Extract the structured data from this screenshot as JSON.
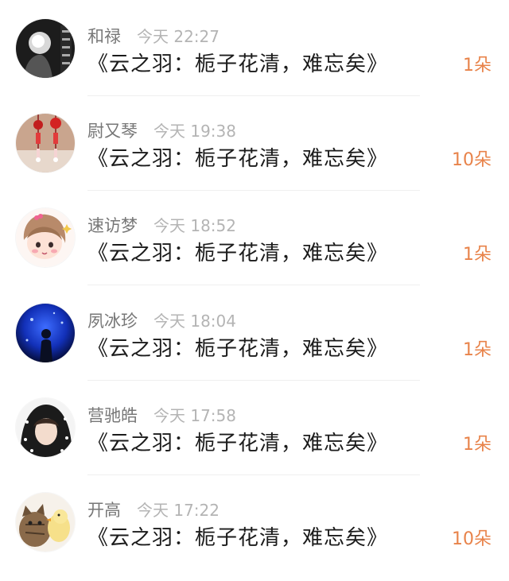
{
  "records": [
    {
      "name": "和禄",
      "time": "今天 22:27",
      "title": "《云之羽：栀子花清，难忘矣》",
      "gift": "1朵",
      "avatar_icon": "user-avatar-dark"
    },
    {
      "name": "尉又琴",
      "time": "今天 19:38",
      "title": "《云之羽：栀子花清，难忘矣》",
      "gift": "10朵",
      "avatar_icon": "user-avatar-lanterns"
    },
    {
      "name": "速访梦",
      "time": "今天 18:52",
      "title": "《云之羽：栀子花清，难忘矣》",
      "gift": "1朵",
      "avatar_icon": "user-avatar-cartoon-girl"
    },
    {
      "name": "夙冰珍",
      "time": "今天 18:04",
      "title": "《云之羽：栀子花清，难忘矣》",
      "gift": "1朵",
      "avatar_icon": "user-avatar-blue-silhouette"
    },
    {
      "name": "营驰皓",
      "time": "今天 17:58",
      "title": "《云之羽：栀子花清，难忘矣》",
      "gift": "1朵",
      "avatar_icon": "user-avatar-hooded-person"
    },
    {
      "name": "开高",
      "time": "今天 17:22",
      "title": "《云之羽：栀子花清，难忘矣》",
      "gift": "10朵",
      "avatar_icon": "user-avatar-cat-duck"
    }
  ],
  "colors": {
    "name": "#777777",
    "time": "#b4b4b4",
    "title": "#1b1b1b",
    "gift": "#e8834a",
    "divider": "#efefef"
  }
}
